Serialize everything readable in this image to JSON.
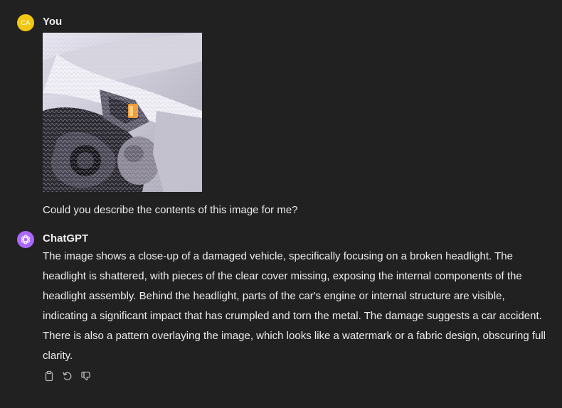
{
  "user_message": {
    "avatar_initials": "CA",
    "avatar_color": "#f2c713",
    "author": "You",
    "text": "Could you describe the contents of this image for me?"
  },
  "assistant_message": {
    "author": "ChatGPT",
    "avatar_color": "#ab68ff",
    "avatar_icon": "openai-logo-icon",
    "text": "The image shows a close-up of a damaged vehicle, specifically focusing on a broken headlight. The headlight is shattered, with pieces of the clear cover missing, exposing the internal components of the headlight assembly. Behind the headlight, parts of the car's engine or internal structure are visible, indicating a significant impact that has crumpled and torn the metal. The damage suggests a car accident. There is also a pattern overlaying the image, which looks like a watermark or a fabric design, obscuring full clarity.",
    "actions": [
      {
        "name": "copy-icon"
      },
      {
        "name": "regenerate-icon"
      },
      {
        "name": "thumbs-down-icon"
      }
    ]
  },
  "colors": {
    "background": "#212121",
    "text": "#ececec",
    "muted_icon": "#b4b4b4"
  }
}
